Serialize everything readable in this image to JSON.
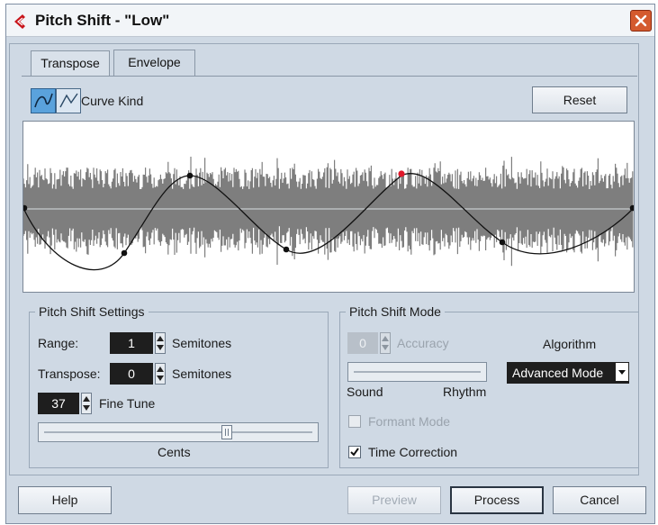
{
  "window": {
    "title": "Pitch Shift - \"Low\""
  },
  "tabs": [
    {
      "label": "Transpose"
    },
    {
      "label": "Envelope"
    }
  ],
  "toolbar": {
    "curve_kind_label": "Curve Kind",
    "reset_label": "Reset"
  },
  "pitch_shift_settings": {
    "title": "Pitch Shift Settings",
    "range_label": "Range:",
    "range_value": "1",
    "range_unit": "Semitones",
    "transpose_label": "Transpose:",
    "transpose_value": "0",
    "transpose_unit": "Semitones",
    "fine_tune_value": "37",
    "fine_tune_label": "Fine Tune",
    "cents_label": "Cents",
    "cents_slider_fraction": 0.68
  },
  "pitch_shift_mode": {
    "title": "Pitch Shift Mode",
    "accuracy_value": "0",
    "accuracy_label": "Accuracy",
    "algorithm_label": "Algorithm",
    "algorithm_value": "Advanced Mode",
    "sound_label": "Sound",
    "rhythm_label": "Rhythm",
    "formant_mode_label": "Formant Mode",
    "formant_mode_checked": false,
    "time_correction_label": "Time Correction",
    "time_correction_checked": true
  },
  "buttons": {
    "help": "Help",
    "preview": "Preview",
    "process": "Process",
    "cancel": "Cancel"
  },
  "colors": {
    "window_bg": "#cfd9e4",
    "waveform": "#7e7e7e",
    "node": "#111111",
    "selected_node": "#e0182a",
    "close_button": "#d45a2e",
    "curve_button_active": "#5aa2dc"
  }
}
